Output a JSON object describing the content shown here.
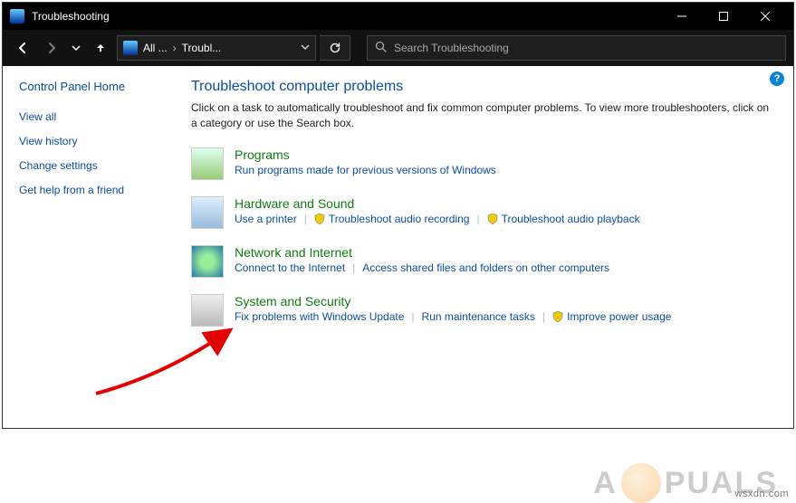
{
  "titlebar": {
    "title": "Troubleshooting"
  },
  "address": {
    "segment1": "All ...",
    "segment2": "Troubl..."
  },
  "search": {
    "placeholder": "Search Troubleshooting"
  },
  "sidebar": {
    "home": "Control Panel Home",
    "links": {
      "view_all": "View all",
      "view_history": "View history",
      "change_settings": "Change settings",
      "get_help": "Get help from a friend"
    }
  },
  "main": {
    "heading": "Troubleshoot computer problems",
    "desc": "Click on a task to automatically troubleshoot and fix common computer problems. To view more troubleshooters, click on a category or use the Search box."
  },
  "categories": {
    "programs": {
      "title": "Programs",
      "link1": "Run programs made for previous versions of Windows"
    },
    "hardware": {
      "title": "Hardware and Sound",
      "link1": "Use a printer",
      "link2": "Troubleshoot audio recording",
      "link3": "Troubleshoot audio playback"
    },
    "network": {
      "title": "Network and Internet",
      "link1": "Connect to the Internet",
      "link2": "Access shared files and folders on other computers"
    },
    "system": {
      "title": "System and Security",
      "link1": "Fix problems with Windows Update",
      "link2": "Run maintenance tasks",
      "link3": "Improve power usage"
    }
  },
  "help_badge": "?",
  "watermark": {
    "pre": "A",
    "post": "PUALS"
  },
  "site_url": "wsxdn.com"
}
